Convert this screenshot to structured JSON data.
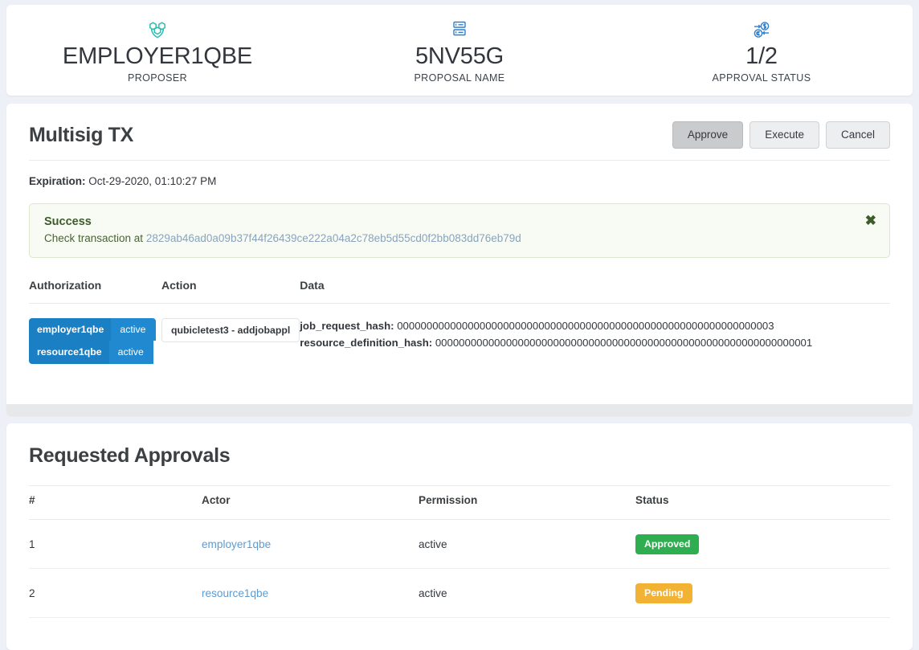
{
  "summary": {
    "columns": [
      {
        "icon": "hexagon-molecule-icon",
        "value": "EMPLOYER1QBE",
        "label": "PROPOSER"
      },
      {
        "icon": "server-stack-icon",
        "value": "5NV55G",
        "label": "PROPOSAL NAME"
      },
      {
        "icon": "currency-exchange-icon",
        "value": "1/2",
        "label": "APPROVAL STATUS"
      }
    ]
  },
  "multisig": {
    "title": "Multisig TX",
    "buttons": [
      {
        "label": "Approve",
        "state": "active"
      },
      {
        "label": "Execute",
        "state": "default"
      },
      {
        "label": "Cancel",
        "state": "default"
      }
    ],
    "expiration_label": "Expiration:",
    "expiration_value": " Oct-29-2020, 01:10:27 PM",
    "alert": {
      "type": "success",
      "title": "Success",
      "text": "Check transaction at ",
      "link": "2829ab46ad0a09b37f44f26439ce222a04a2c78eb5d55cd0f2bb083dd76eb79d",
      "close_label": "✖"
    },
    "table": {
      "headers": {
        "authorization": "Authorization",
        "action": "Action",
        "data": "Data"
      },
      "authorizations": [
        {
          "actor": "employer1qbe",
          "permission": "active"
        },
        {
          "actor": "resource1qbe",
          "permission": "active"
        }
      ],
      "action": "qubicletest3 - addjobappl",
      "data": [
        {
          "key": "job_request_hash:",
          "value": " 0000000000000000000000000000000000000000000000000000000000000003"
        },
        {
          "key": "resource_definition_hash:",
          "value": " 0000000000000000000000000000000000000000000000000000000000000001"
        }
      ]
    }
  },
  "approvals": {
    "title": "Requested Approvals",
    "headers": [
      "#",
      "Actor",
      "Permission",
      "Status"
    ],
    "rows": [
      {
        "num": "1",
        "actor": "employer1qbe",
        "permission": "active",
        "status": "Approved",
        "status_type": "approved"
      },
      {
        "num": "2",
        "actor": "resource1qbe",
        "permission": "active",
        "status": "Pending",
        "status_type": "pending"
      }
    ]
  },
  "colors": {
    "page_bg": "#eef0f8",
    "accent_blue": "#1b7fc4",
    "approved_green": "#2eae50",
    "pending_amber": "#f2b233",
    "link_blue": "#5d9bd1",
    "icon_teal": "#2bbfb0",
    "icon_blue": "#2f7fd1"
  }
}
